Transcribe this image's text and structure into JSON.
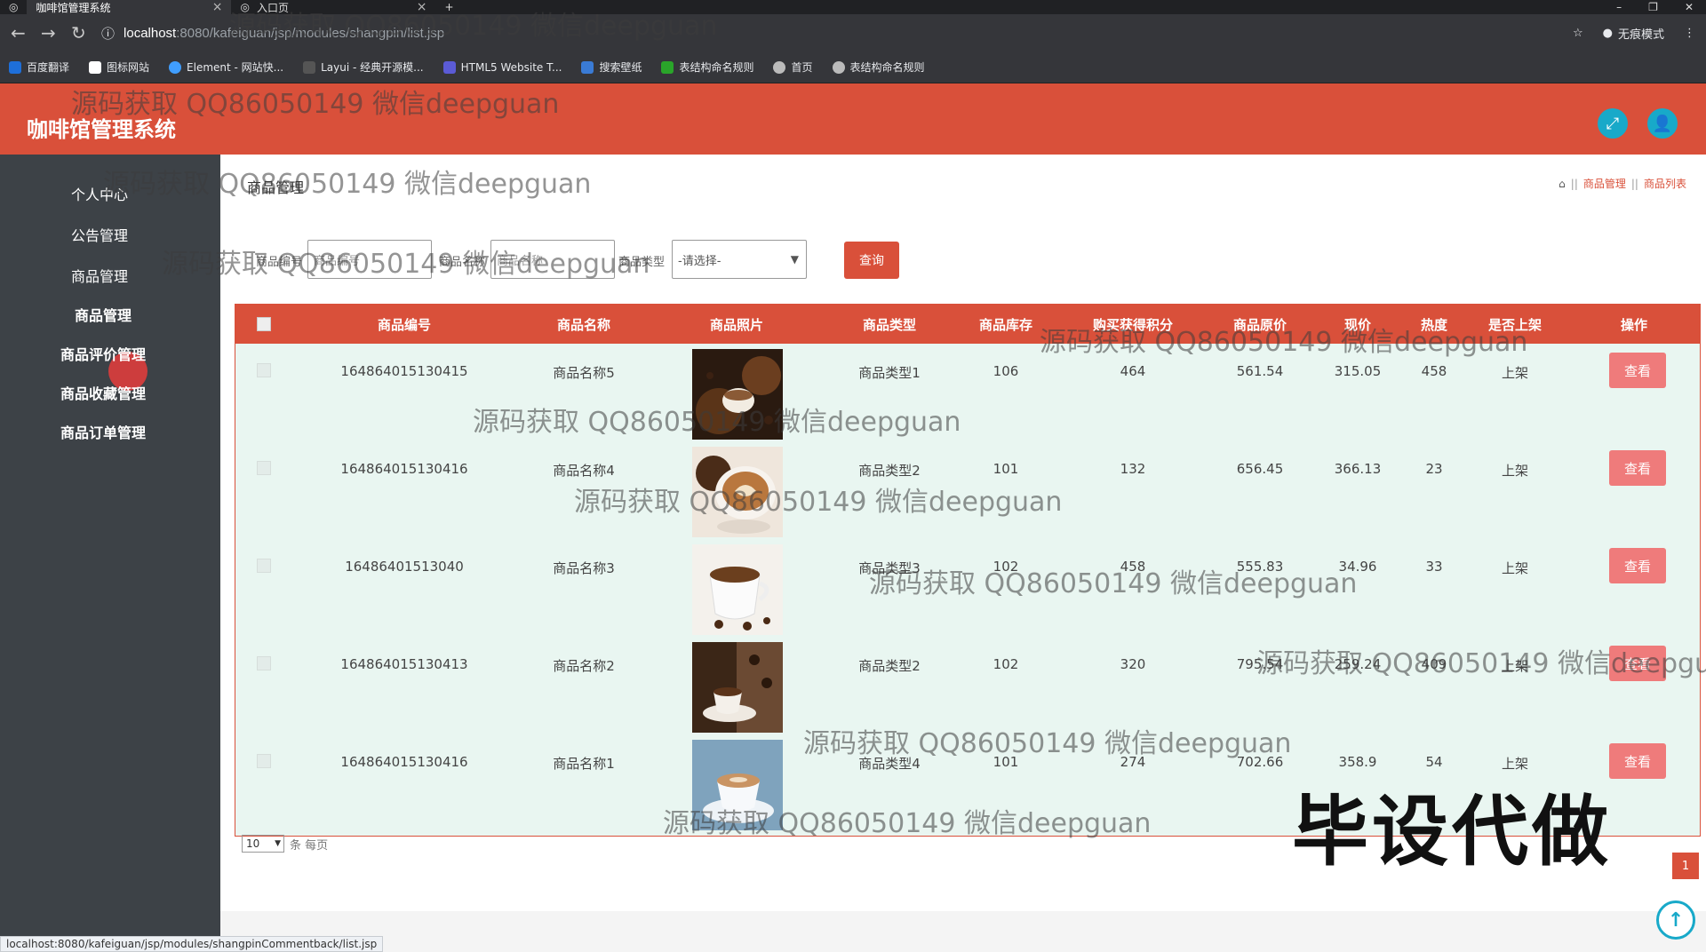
{
  "browser": {
    "tabs": [
      {
        "label": "咖啡馆管理系统",
        "active": true
      },
      {
        "label": "入口页",
        "active": false
      }
    ],
    "url_host": "localhost",
    "url_path": ":8080/kafeiguan/jsp/modules/shangpin/list.jsp",
    "profile_label": "无痕模式",
    "bookmarks": [
      "百度翻译",
      "图标网站",
      "Element - 网站快...",
      "Layui - 经典开源模...",
      "HTML5 Website T...",
      "搜索壁纸",
      "表结构命名规则",
      "首页",
      "表结构命名规则"
    ]
  },
  "app": {
    "title": "咖啡馆管理系统",
    "accent_color": "#d9503a"
  },
  "sidebar": {
    "items": [
      {
        "label": "个人中心"
      },
      {
        "label": "公告管理"
      },
      {
        "label": "商品管理"
      },
      {
        "label": "商品管理"
      },
      {
        "label": "商品评价管理"
      },
      {
        "label": "商品收藏管理"
      },
      {
        "label": "商品订单管理"
      }
    ]
  },
  "main": {
    "heading": "商品管理",
    "breadcrumb": [
      "商品管理",
      "商品列表"
    ],
    "search": {
      "field1_label": "商品编号",
      "field1_placeholder": "商品编号",
      "field2_label": "商品名称",
      "field2_placeholder": "商品名称",
      "type_label": "商品类型",
      "type_value": "-请选择-",
      "query_label": "查询"
    },
    "table": {
      "headers": [
        "商品编号",
        "商品名称",
        "商品照片",
        "商品类型",
        "商品库存",
        "购买获得积分",
        "商品原价",
        "现价",
        "热度",
        "是否上架",
        "操作"
      ],
      "rows": [
        {
          "code": "164864015130415",
          "name": "商品名称5",
          "type": "商品类型1",
          "stock": "106",
          "points": "464",
          "orig": "561.54",
          "price": "315.05",
          "heat": "458",
          "status": "上架",
          "action": "查看",
          "photo": "coffee-beans-cup"
        },
        {
          "code": "164864015130416",
          "name": "商品名称4",
          "type": "商品类型2",
          "stock": "101",
          "points": "132",
          "orig": "656.45",
          "price": "366.13",
          "heat": "23",
          "status": "上架",
          "action": "查看",
          "photo": "latte-art"
        },
        {
          "code": "16486401513040",
          "name": "商品名称3",
          "type": "商品类型3",
          "stock": "102",
          "points": "458",
          "orig": "555.83",
          "price": "34.96",
          "heat": "33",
          "status": "上架",
          "action": "查看",
          "photo": "white-cup-beans"
        },
        {
          "code": "164864015130413",
          "name": "商品名称2",
          "type": "商品类型2",
          "stock": "102",
          "points": "320",
          "orig": "795.54",
          "price": "259.24",
          "heat": "409",
          "status": "上架",
          "action": "查看",
          "photo": "espresso-pour"
        },
        {
          "code": "164864015130416",
          "name": "商品名称1",
          "type": "商品类型4",
          "stock": "101",
          "points": "274",
          "orig": "702.66",
          "price": "358.9",
          "heat": "54",
          "status": "上架",
          "action": "查看",
          "photo": "blue-cup"
        }
      ]
    },
    "pager": {
      "page_size": "10",
      "suffix": "条 每页",
      "current_page": "1"
    }
  },
  "status_url": "localhost:8080/kafeiguan/jsp/modules/shangpinCommentback/list.jsp",
  "watermarks": {
    "text": "源码获取 QQ86050149 微信deepguan",
    "big": "毕设代做"
  }
}
